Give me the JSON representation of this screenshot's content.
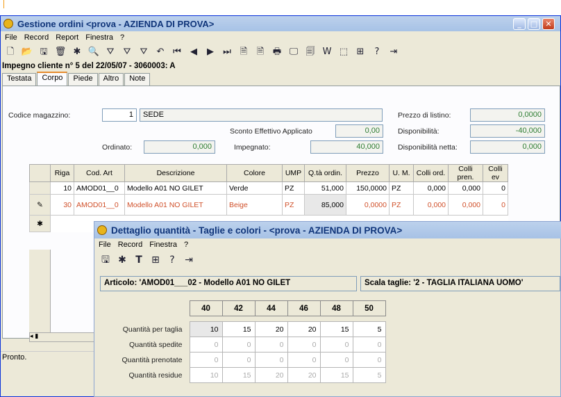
{
  "main_window": {
    "title": "Gestione ordini <prova - AZIENDA DI PROVA>",
    "menu": [
      "File",
      "Record",
      "Report",
      "Finestra",
      "?"
    ],
    "heading": "Impegno cliente n° 5 del 22/05/07 - 3060003: A",
    "tabs": [
      "Testata",
      "Corpo",
      "Piede",
      "Altro",
      "Note"
    ],
    "active_tab": "Corpo",
    "form": {
      "codice_magazzino_label": "Codice magazzino:",
      "codice_magazzino_value": "1",
      "magazzino_desc": "SEDE",
      "prezzo_listino_label": "Prezzo di listino:",
      "prezzo_listino_value": "0,0000",
      "sconto_label": "Sconto Effettivo Applicato",
      "sconto_value": "0,00",
      "disponibilita_label": "Disponibilità:",
      "disponibilita_value": "-40,000",
      "ordinato_label": "Ordinato:",
      "ordinato_value": "0,000",
      "impegnato_label": "Impegnato:",
      "impegnato_value": "40,000",
      "disp_netta_label": "Disponibilità netta:",
      "disp_netta_value": "0,000"
    },
    "grid_headers": [
      "Riga",
      "Cod. Art",
      "Descrizione",
      "Colore",
      "UMP",
      "Q.tà ordin.",
      "Prezzo",
      "U. M.",
      "Colli ord.",
      "Colli pren.",
      "Colli ev"
    ],
    "rows": [
      {
        "riga": "10",
        "cod": "AMOD01__0",
        "desc": "Modello A01 NO GILET",
        "colore": "Verde",
        "ump": "PZ",
        "qta": "51,000",
        "prezzo": "150,0000",
        "um": "PZ",
        "colli_ord": "0,000",
        "colli_pren": "0,000",
        "colli_ev": "0"
      },
      {
        "riga": "30",
        "cod": "AMOD01__0",
        "desc": "Modello A01 NO GILET",
        "colore": "Beige",
        "ump": "PZ",
        "qta": "85,000",
        "prezzo": "0,0000",
        "um": "PZ",
        "colli_ord": "0,000",
        "colli_pren": "0,000",
        "colli_ev": "0"
      }
    ],
    "status": "Pronto.",
    "accent_colors": {
      "edit_row": "#d0502a",
      "readonly_value": "#2e7d32"
    }
  },
  "dialog": {
    "title": "Dettaglio quantità - Taglie e colori - <prova - AZIENDA DI PROVA>",
    "menu": [
      "File",
      "Record",
      "Finestra",
      "?"
    ],
    "articolo": "Articolo: 'AMOD01___02 - Modello A01 NO GILET",
    "scala": "Scala taglie: '2 - TAGLIA ITALIANA UOMO'",
    "sizes": [
      "40",
      "42",
      "44",
      "46",
      "48",
      "50"
    ],
    "rows": [
      {
        "label": "Quantità per taglia",
        "values": [
          "10",
          "15",
          "20",
          "20",
          "15",
          "5"
        ]
      },
      {
        "label": "Quantità spedite",
        "values": [
          "0",
          "0",
          "0",
          "0",
          "0",
          "0"
        ]
      },
      {
        "label": "Quantità prenotate",
        "values": [
          "0",
          "0",
          "0",
          "0",
          "0",
          "0"
        ]
      },
      {
        "label": "Quantità residue",
        "values": [
          "10",
          "15",
          "20",
          "20",
          "15",
          "5"
        ]
      }
    ]
  }
}
